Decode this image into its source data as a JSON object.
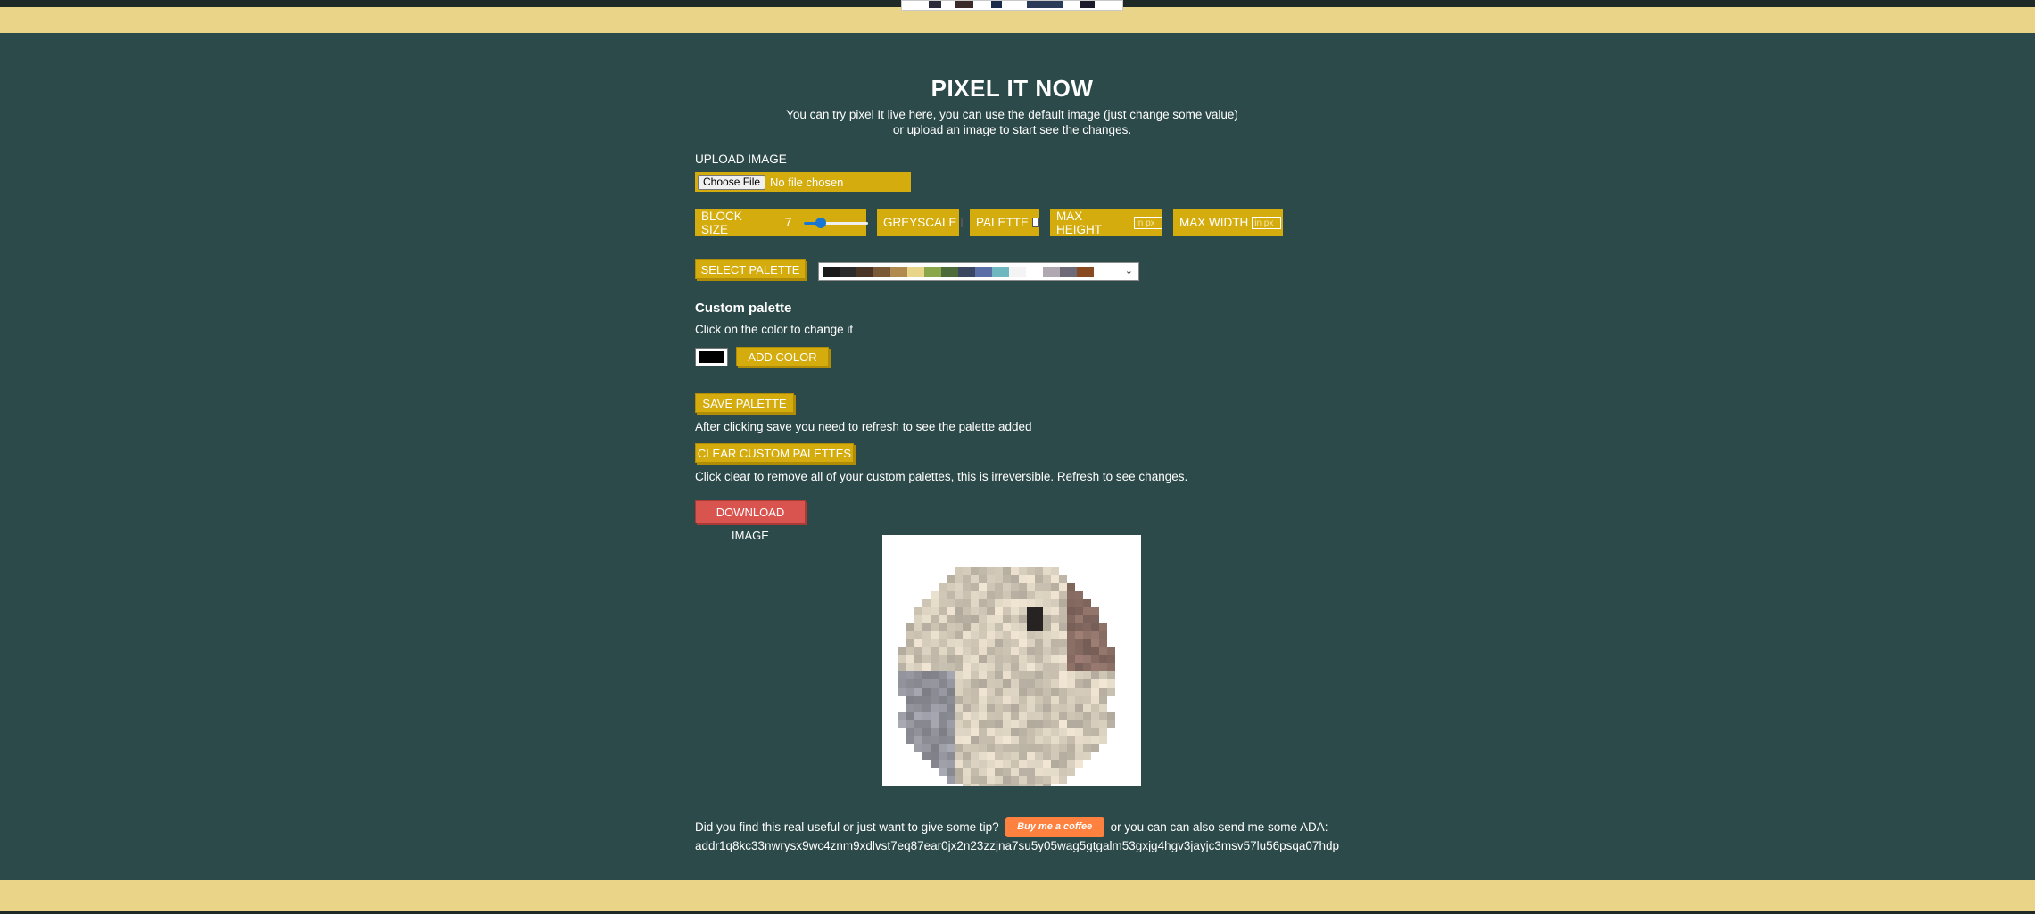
{
  "header": {
    "title": "PIXEL IT NOW",
    "intro": "You can try pixel It live here, you can use the default image (just change some value) or upload an image to start see the changes."
  },
  "upload": {
    "label": "UPLOAD IMAGE",
    "button": "Choose File",
    "status": "No file chosen"
  },
  "controls": {
    "block_size_label": "BLOCK SIZE",
    "block_size_value": "7",
    "block_size_fraction": 0.26,
    "greyscale_label": "GREYSCALE",
    "greyscale_checked": false,
    "palette_label": "PALETTE",
    "palette_checked": false,
    "max_height_label": "MAX HEIGHT",
    "max_height_placeholder": "in px",
    "max_width_label": "MAX WIDTH",
    "max_width_placeholder": "in px"
  },
  "palette": {
    "select_button": "SELECT PALETTE",
    "swatches": [
      "#140c1c",
      "#442434",
      "#30346d",
      "#4e4a4e",
      "#854c30",
      "#346524",
      "#d04648",
      "#757161",
      "#597dce",
      "#d27d2c",
      "#8595a1",
      "#6daa2c",
      "#d2aa99",
      "#6dc2ca",
      "#dad45e",
      "#deeed6"
    ],
    "visible_swatches": [
      "#1a1a1a",
      "#2b2b2b",
      "#4a3426",
      "#7a5a36",
      "#b08a4f",
      "#e8d58a",
      "#8aa84a",
      "#4e6b3a",
      "#3b4660",
      "#5a6ea8",
      "#6fb8c0",
      "#f4f4f4",
      "#ffffff",
      "#b0a8b0",
      "#6e6a78",
      "#8a4a20"
    ]
  },
  "custom_palette": {
    "heading": "Custom palette",
    "hint": "Click on the color to change it",
    "current_color": "#000000",
    "add_color": "ADD COLOR",
    "save": "SAVE PALETTE",
    "save_hint": "After clicking save you need to refresh to see the palette added",
    "clear": "CLEAR CUSTOM PALETTES",
    "clear_hint": "Click clear to remove all of your custom palettes, this is irreversible. Refresh to see changes."
  },
  "download": {
    "label": "DOWNLOAD IMAGE"
  },
  "footer": {
    "tip_text": "Did you find this real useful or just want to give some tip?",
    "bmc_label": "Buy me a coffee",
    "ada_text": "or you can can also send me some ADA:",
    "ada_address": "addr1q8kc33nwrysx9wc4znm9xdlvst7eq87ear0jx2n23zzjna7su5y05wag5gtgalm53gxjg4hgv3jayjc3msv57lu56psqa07hdp"
  },
  "colors": {
    "background": "#2d4a4a",
    "band": "#e9d487",
    "accent": "#d4ac0d",
    "danger": "#d9534f"
  }
}
